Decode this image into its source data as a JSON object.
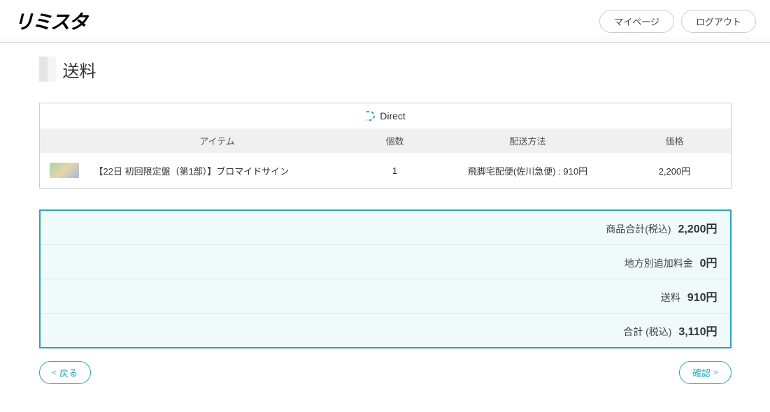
{
  "header": {
    "logo": "リミスタ",
    "mypage": "マイページ",
    "logout": "ログアウト"
  },
  "page": {
    "title": "送料"
  },
  "direct": {
    "label": "Direct"
  },
  "columns": {
    "item": "アイテム",
    "qty": "個数",
    "ship": "配送方法",
    "price": "価格"
  },
  "rows": [
    {
      "item": "【22日 初回限定盤（第1部）】ブロマイドサイン",
      "qty": "1",
      "ship": "飛脚宅配便(佐川急便) : 910円",
      "price": "2,200円"
    }
  ],
  "summary": {
    "subtotal_label": "商品合計(税込)",
    "subtotal_value": "2,200円",
    "surcharge_label": "地方別追加料金",
    "surcharge_value": "0円",
    "shipping_label": "送料",
    "shipping_value": "910円",
    "total_label": "合計 (税込)",
    "total_value": "3,110円"
  },
  "nav": {
    "back": "戻る",
    "confirm": "確認"
  }
}
